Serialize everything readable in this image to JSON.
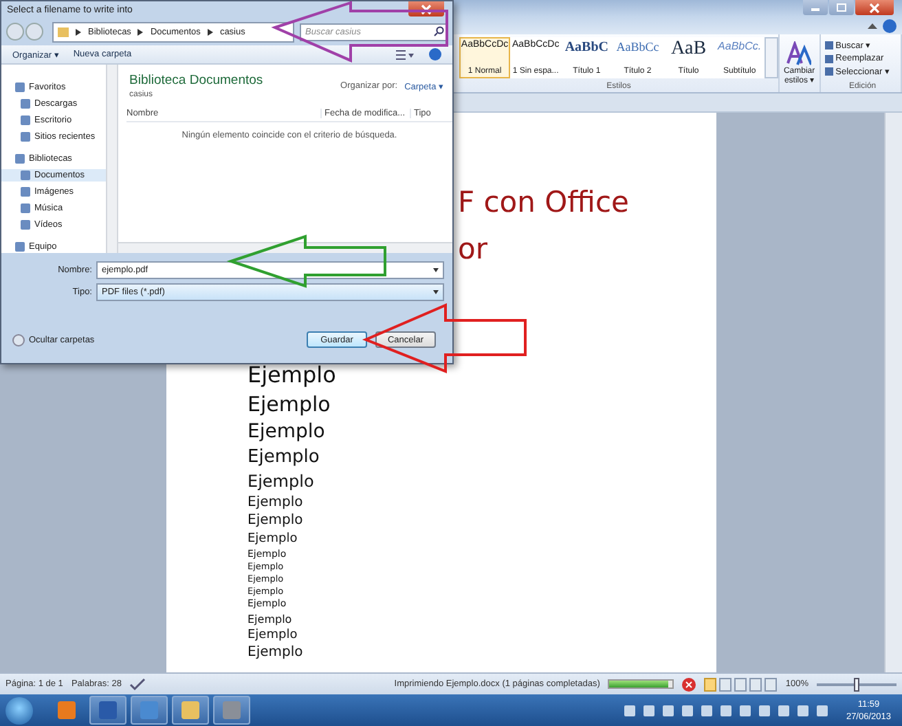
{
  "dialog": {
    "title": "Select a filename to write into",
    "breadcrumb": [
      "Bibliotecas",
      "Documentos",
      "casius"
    ],
    "search": {
      "placeholder": "Buscar casius"
    },
    "toolbar": [
      "Organizar ▾",
      "Nueva carpeta"
    ],
    "nav": [
      {
        "label": "Favoritos",
        "kind": "group",
        "selected": false
      },
      {
        "label": "Descargas",
        "kind": "item",
        "selected": false
      },
      {
        "label": "Escritorio",
        "kind": "item",
        "selected": false
      },
      {
        "label": "Sitios recientes",
        "kind": "item",
        "selected": false
      },
      {
        "label": "Bibliotecas",
        "kind": "group",
        "selected": false
      },
      {
        "label": "Documentos",
        "kind": "item",
        "selected": true
      },
      {
        "label": "Imágenes",
        "kind": "item",
        "selected": false
      },
      {
        "label": "Música",
        "kind": "item",
        "selected": false
      },
      {
        "label": "Vídeos",
        "kind": "item",
        "selected": false
      },
      {
        "label": "Equipo",
        "kind": "group",
        "selected": false
      }
    ],
    "library": {
      "title": "Biblioteca Documentos",
      "subtitle": "casius",
      "arrange_label": "Organizar por:",
      "arrange_value": "Carpeta ▾"
    },
    "columns": [
      "Nombre",
      "Fecha de modifica...",
      "Tipo"
    ],
    "empty_message": "Ningún elemento coincide con el criterio de búsqueda.",
    "filename": {
      "label": "Nombre:",
      "value": "ejemplo.pdf"
    },
    "filetype": {
      "label": "Tipo:",
      "value": "PDF files (*.pdf)"
    },
    "hide_folders": "Ocultar carpetas",
    "buttons": [
      {
        "label": "Guardar",
        "kind": "default"
      },
      {
        "label": "Cancelar",
        "kind": "normal"
      }
    ]
  },
  "ribbon": {
    "styles": [
      {
        "preview": "AaBbCcDc",
        "label": "1 Normal",
        "kind": "normal",
        "selected": true
      },
      {
        "preview": "AaBbCcDc",
        "label": "1 Sin espa...",
        "kind": "normal",
        "selected": false
      },
      {
        "preview": "AaBbC",
        "label": "Título 1",
        "kind": "heading1",
        "selected": false
      },
      {
        "preview": "AaBbCc",
        "label": "Título 2",
        "kind": "heading2",
        "selected": false
      },
      {
        "preview": "AaB",
        "label": "Título",
        "kind": "title",
        "selected": false
      },
      {
        "preview": "AaBbCc.",
        "label": "Subtítulo",
        "kind": "subtitle",
        "selected": false
      }
    ],
    "styles_group": "Estilos",
    "change_styles": "Cambiar estilos ▾",
    "editing": [
      "Buscar ▾",
      "Reemplazar",
      "Seleccionar ▾"
    ],
    "editing_group": "Edición"
  },
  "document": {
    "headings": [
      "F con Office",
      "or"
    ],
    "lines": [
      "Ejemplo",
      "Ejemplo",
      "Ejemplo",
      "Ejemplo",
      "Ejemplo",
      "Ejemplo",
      "Ejemplo",
      "Ejemplo",
      "Ejemplo",
      "Ejemplo",
      "Ejemplo",
      "Ejemplo",
      "Ejemplo",
      "Ejemplo",
      "Ejemplo",
      "Ejemplo"
    ]
  },
  "status_bar": {
    "page": "Página: 1 de 1",
    "words": "Palabras: 28",
    "printing": "Imprimiendo Ejemplo.docx (1 páginas completadas)",
    "progress": {
      "level": 0.92
    },
    "zoom": "100%",
    "zoom_slider": {
      "level": 0.5
    }
  },
  "taskbar": {
    "apps": [
      {
        "kind": "media"
      },
      {
        "kind": "word"
      },
      {
        "kind": "network"
      },
      {
        "kind": "folder"
      },
      {
        "kind": "pdf"
      }
    ],
    "time": "11:59",
    "date": "27/06/2013"
  }
}
